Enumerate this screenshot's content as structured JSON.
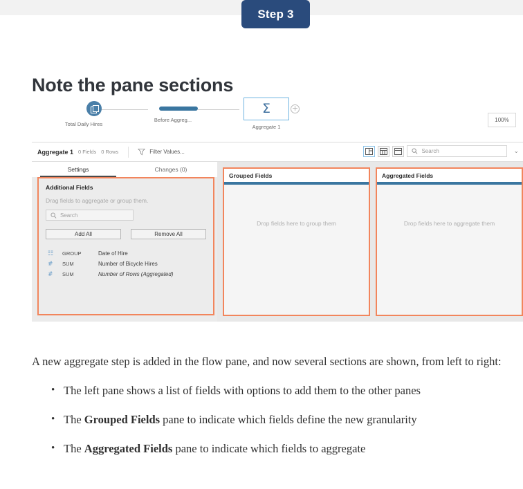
{
  "step_badge": {
    "label": "Step 3"
  },
  "page_title": "Note the pane sections",
  "app": {
    "flow": {
      "nodes": [
        {
          "label": "Total Daily Hires",
          "icon": "input-file-icon"
        },
        {
          "label": "Before Aggreg...",
          "icon": "clean-step-icon"
        },
        {
          "label": "Aggregate 1",
          "icon": "sigma-icon",
          "glyph": "Σ"
        }
      ],
      "add_step_glyph": "+",
      "zoom_level": "100%"
    },
    "toolbar": {
      "title": "Aggregate 1",
      "fields_count": "0 Fields",
      "rows_count": "0 Rows",
      "filter_label": "Filter Values...",
      "view_buttons": [
        {
          "name": "split-pane-view-icon",
          "selected": true
        },
        {
          "name": "grid-view-icon",
          "selected": false
        },
        {
          "name": "list-view-icon",
          "selected": false
        }
      ],
      "search_placeholder": "Search",
      "collapse_glyph": "⌄"
    },
    "tabs": [
      {
        "label": "Settings",
        "active": true
      },
      {
        "label": "Changes (0)",
        "active": false
      }
    ],
    "left_pane": {
      "title": "Additional Fields",
      "hint": "Drag fields to aggregate or group them.",
      "search_placeholder": "Search",
      "add_all_label": "Add All",
      "remove_all_label": "Remove All",
      "fields": [
        {
          "icon": "calendar-icon",
          "icon_glyph": "☷",
          "role": "GROUP",
          "name": "Date of Hire",
          "italic": false
        },
        {
          "icon": "number-icon",
          "icon_glyph": "#",
          "role": "SUM",
          "name": "Number of Bicycle Hires",
          "italic": false
        },
        {
          "icon": "number-icon",
          "icon_glyph": "#",
          "role": "SUM",
          "name": "Number of Rows (Aggregated)",
          "italic": true
        }
      ]
    },
    "grouped_pane": {
      "title": "Grouped Fields",
      "drop_hint": "Drop fields here to group them"
    },
    "aggregated_pane": {
      "title": "Aggregated Fields",
      "drop_hint": "Drop fields here to aggregate them"
    },
    "colors": {
      "highlight_border": "#f2855c",
      "accent_blue": "#3a76a0",
      "badge_blue": "#2a4b7c"
    }
  },
  "article": {
    "paragraph": "A new aggregate step is added in the flow pane, and now several sections are shown, from left to right:",
    "bullets": [
      {
        "prefix": "The left pane shows a list of fields with options to add them to the other panes",
        "bold": "",
        "suffix": ""
      },
      {
        "prefix": "The ",
        "bold": "Grouped Fields",
        "suffix": " pane to indicate which fields define the new granularity"
      },
      {
        "prefix": "The ",
        "bold": "Aggregated Fields",
        "suffix": " pane to indicate which fields to aggregate"
      }
    ]
  }
}
